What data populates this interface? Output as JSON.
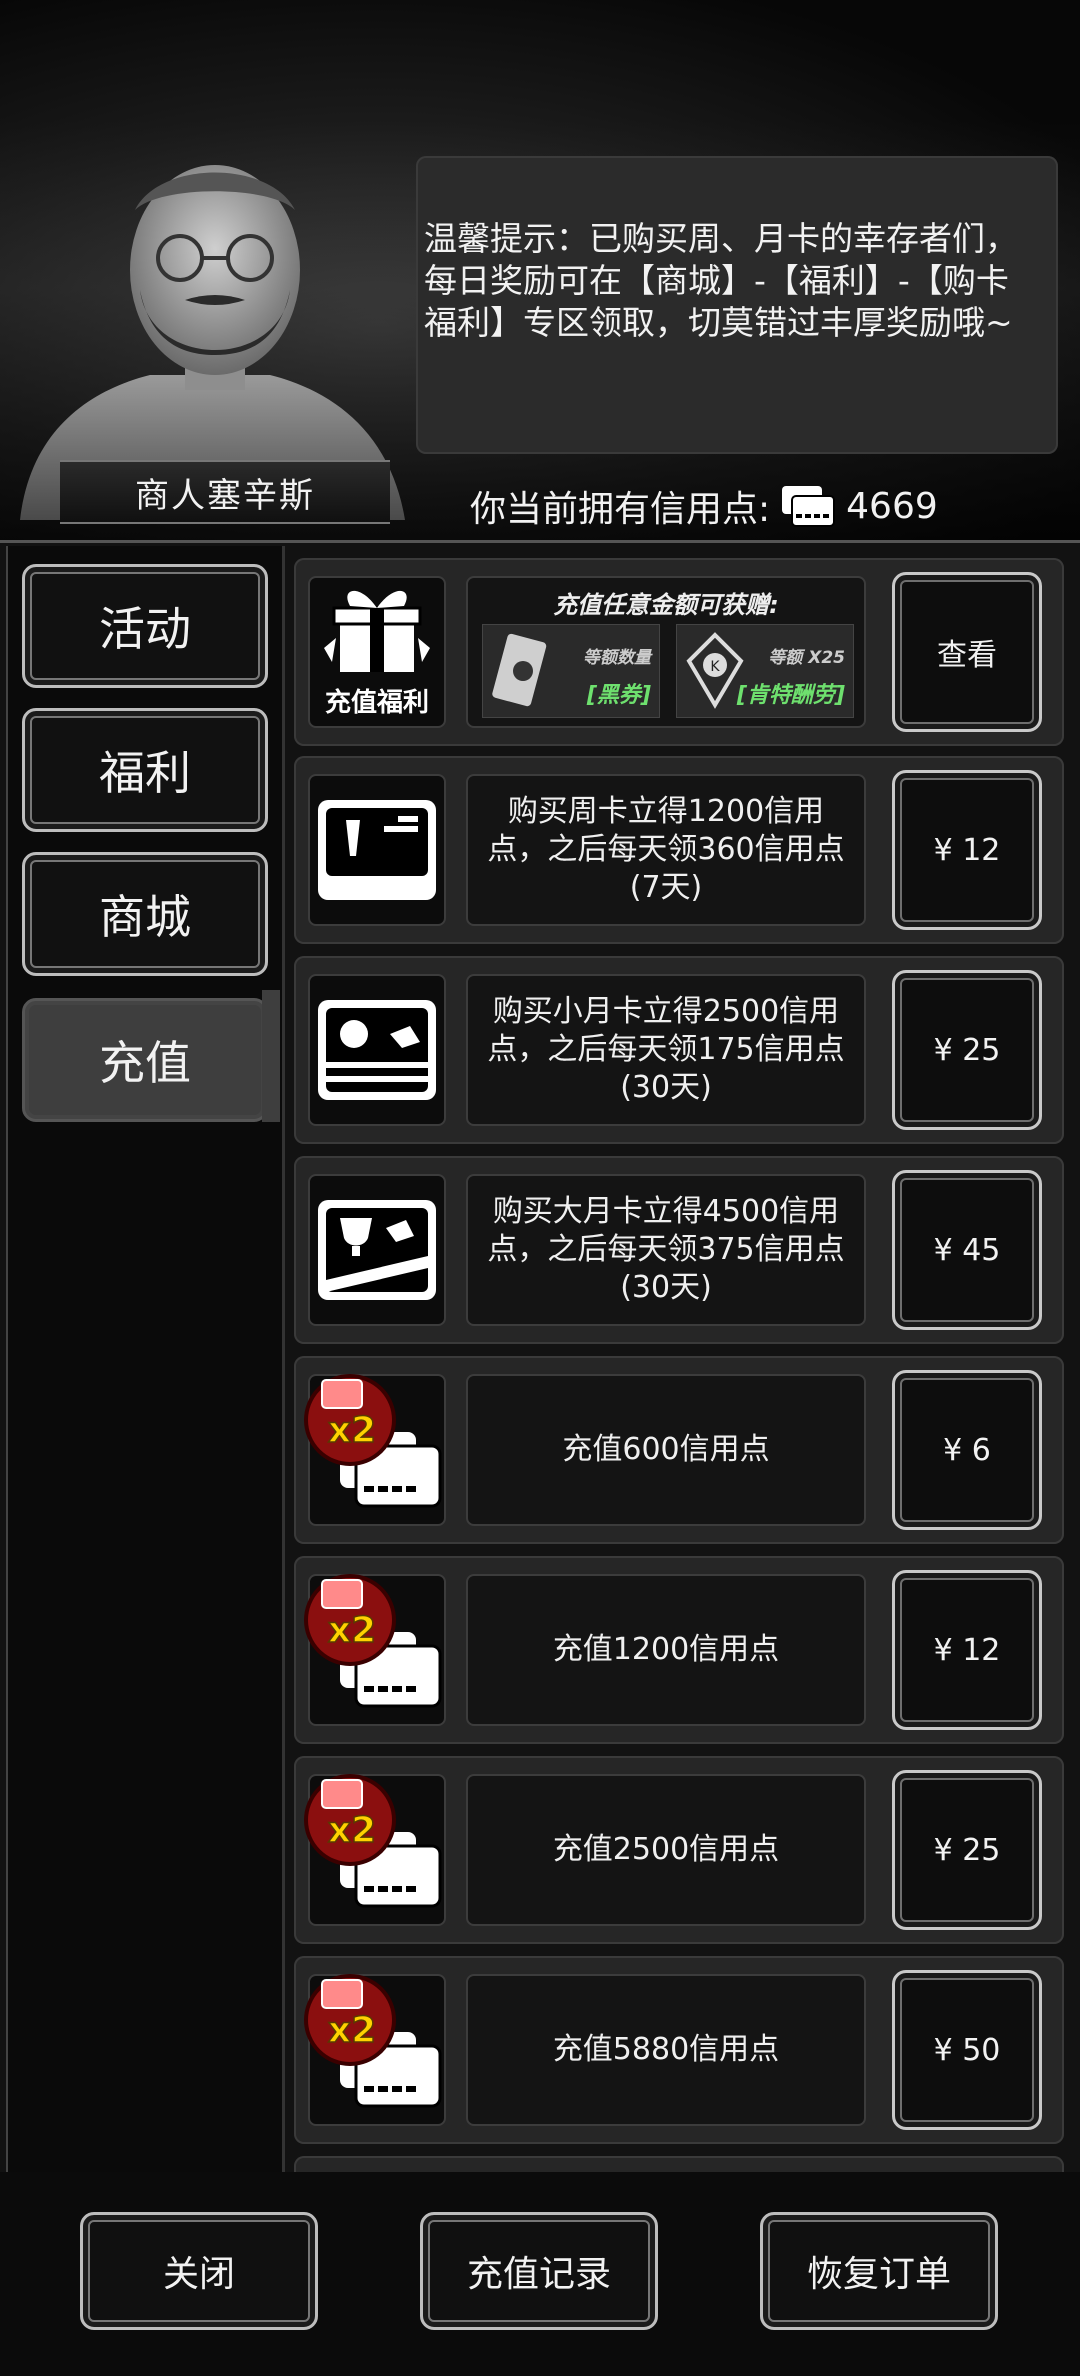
{
  "header": {
    "merchant_name": "商人塞辛斯",
    "tip": "温馨提示：已购买周、月卡的幸存者们，每日奖励可在【商城】-【福利】-【购卡福利】专区领取，切莫错过丰厚奖励哦~",
    "credits_label": "你当前拥有信用点:",
    "credits_value": "4669"
  },
  "sidebar": {
    "items": [
      {
        "label": "活动"
      },
      {
        "label": "福利"
      },
      {
        "label": "商城"
      },
      {
        "label": "充值"
      }
    ],
    "active_index": 3
  },
  "promo": {
    "icon_label": "充值福利",
    "title": "充值任意金额可获赠:",
    "items": [
      {
        "top": "等额数量",
        "bottom": "[黑券]"
      },
      {
        "top": "等额 X25",
        "bottom": "[肯特酬劳]"
      }
    ],
    "button": "查看"
  },
  "rows": [
    {
      "icon": "week-card-icon",
      "desc": "购买周卡立得1200信用点，之后每天领360信用点(7天)",
      "price": "¥ 12"
    },
    {
      "icon": "small-month-card-icon",
      "desc": "购买小月卡立得2500信用点，之后每天领175信用点(30天)",
      "price": "¥ 25"
    },
    {
      "icon": "big-month-card-icon",
      "desc": "购买大月卡立得4500信用点，之后每天领375信用点(30天)",
      "price": "¥ 45"
    },
    {
      "icon": "credit-cards-icon",
      "desc": "充值600信用点",
      "price": "¥ 6",
      "bonus": "x2"
    },
    {
      "icon": "credit-cards-icon",
      "desc": "充值1200信用点",
      "price": "¥ 12",
      "bonus": "x2"
    },
    {
      "icon": "credit-cards-icon",
      "desc": "充值2500信用点",
      "price": "¥ 25",
      "bonus": "x2"
    },
    {
      "icon": "credit-cards-icon",
      "desc": "充值5880信用点",
      "price": "¥ 50",
      "bonus": "x2"
    }
  ],
  "footer": {
    "close": "关闭",
    "history": "充值记录",
    "restore": "恢复订单"
  }
}
